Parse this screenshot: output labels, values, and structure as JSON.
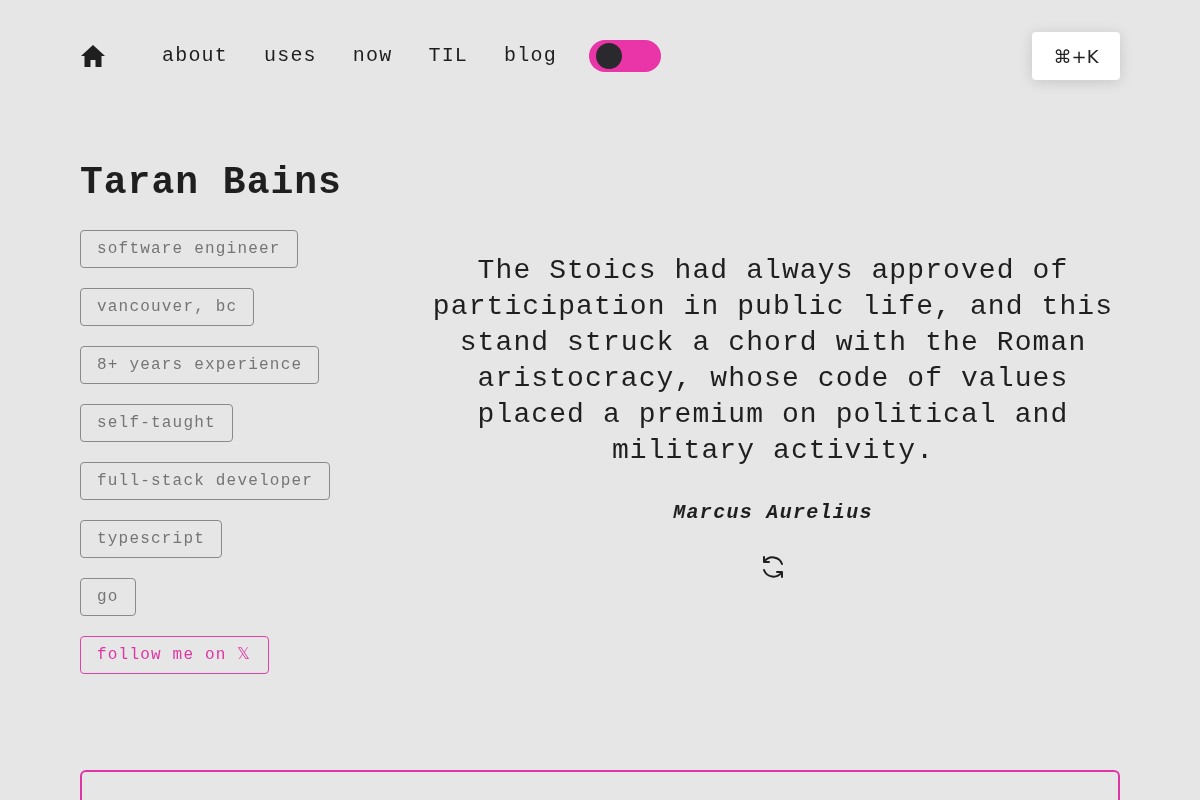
{
  "nav": {
    "items": [
      {
        "label": "about"
      },
      {
        "label": "uses"
      },
      {
        "label": "now"
      },
      {
        "label": "TIL"
      },
      {
        "label": "blog"
      }
    ],
    "theme_toggle": {
      "on": false
    }
  },
  "search_button": {
    "label": "⌘+K"
  },
  "profile": {
    "name": "Taran Bains",
    "tags": [
      {
        "kind": "tag",
        "label": "software engineer"
      },
      {
        "kind": "tag",
        "label": "vancouver, bc"
      },
      {
        "kind": "tag",
        "label": "8+ years experience"
      },
      {
        "kind": "tag",
        "label": "self-taught"
      },
      {
        "kind": "tag",
        "label": "full-stack developer"
      },
      {
        "kind": "tag",
        "label": "typescript"
      },
      {
        "kind": "tag",
        "label": "go"
      },
      {
        "kind": "link",
        "label": "follow me on 𝕏"
      }
    ]
  },
  "quote": {
    "text": "The Stoics had always approved of participation in public life, and this stand struck a chord with the Roman aristocracy, whose code of values placed a premium on political and military activity.",
    "author": "Marcus Aurelius"
  }
}
